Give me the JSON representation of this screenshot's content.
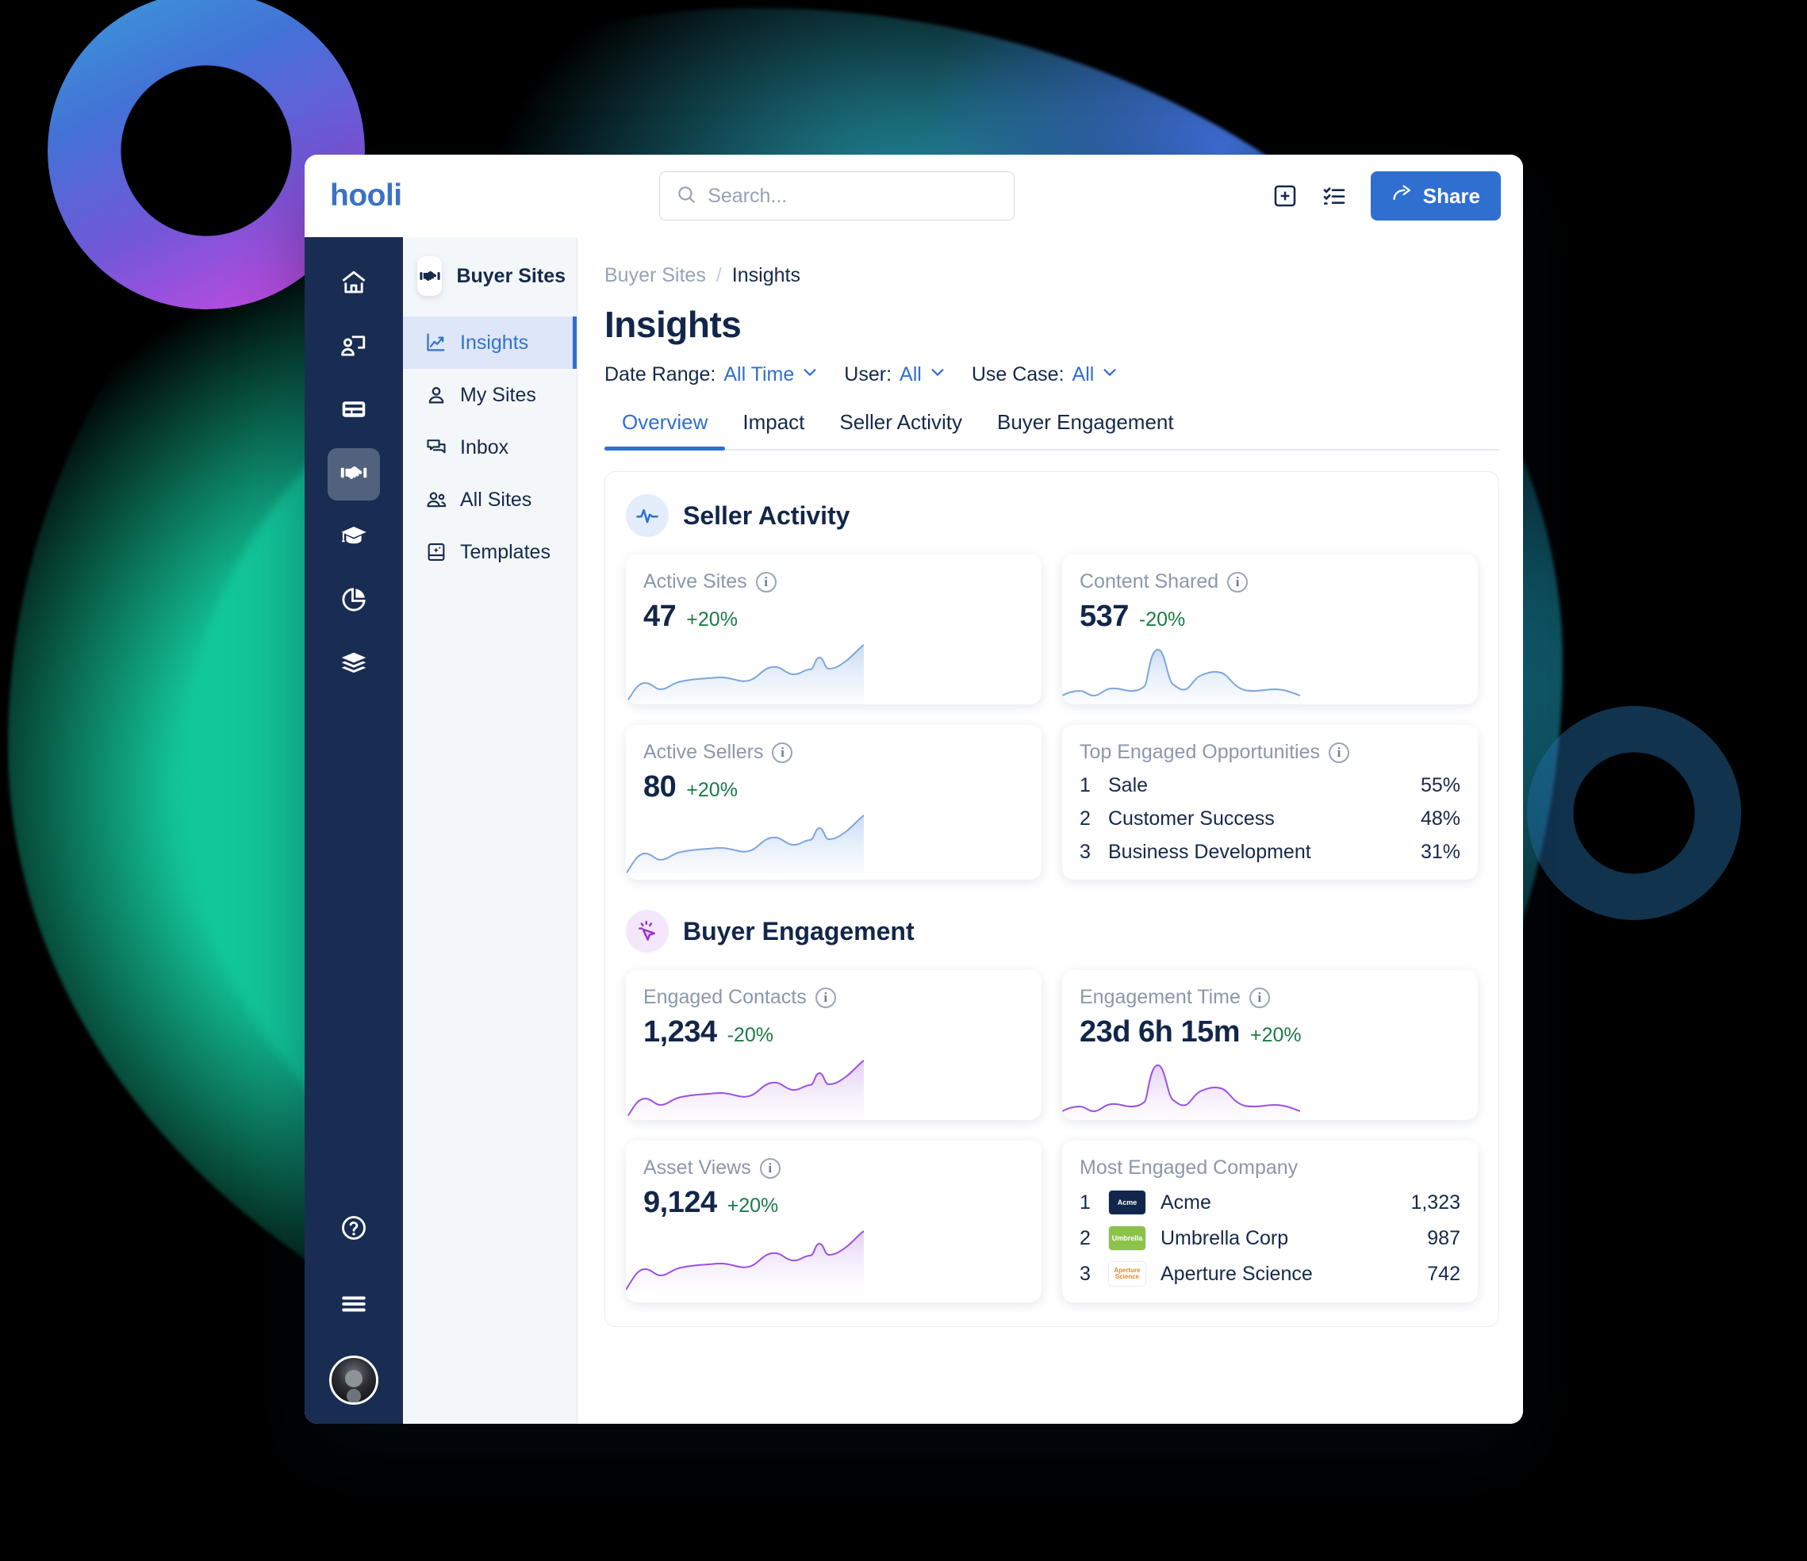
{
  "brand": {
    "name": "hooli",
    "color": "#3b72c4"
  },
  "topbar": {
    "search_placeholder": "Search...",
    "share_label": "Share",
    "icons": [
      "add-panel-icon",
      "checklist-icon",
      "share-icon"
    ]
  },
  "rail": {
    "items": [
      {
        "name": "home",
        "icon": "home-icon",
        "active": false
      },
      {
        "name": "presentations",
        "icon": "user-screen-icon",
        "active": false
      },
      {
        "name": "cards",
        "icon": "card-icon",
        "active": false
      },
      {
        "name": "buyer-sites",
        "icon": "handshake-icon",
        "active": true
      },
      {
        "name": "learning",
        "icon": "graduation-cap-icon",
        "active": false
      },
      {
        "name": "analytics",
        "icon": "pie-chart-icon",
        "active": false
      },
      {
        "name": "library",
        "icon": "stack-icon",
        "active": false
      }
    ],
    "bottom": [
      {
        "name": "help",
        "icon": "question-circle-icon"
      },
      {
        "name": "menu",
        "icon": "hamburger-icon"
      },
      {
        "name": "profile",
        "icon": "avatar"
      }
    ]
  },
  "subnav": {
    "title": "Buyer Sites",
    "title_icon": "handshake-icon",
    "items": [
      {
        "label": "Insights",
        "icon": "chart-line-icon",
        "active": true
      },
      {
        "label": "My Sites",
        "icon": "user-icon",
        "active": false
      },
      {
        "label": "Inbox",
        "icon": "chat-icon",
        "active": false
      },
      {
        "label": "All Sites",
        "icon": "users-icon",
        "active": false
      },
      {
        "label": "Templates",
        "icon": "template-icon",
        "active": false
      }
    ]
  },
  "breadcrumb": {
    "parent": "Buyer Sites",
    "separator": "/",
    "current": "Insights"
  },
  "page_title": "Insights",
  "filters": [
    {
      "label": "Date Range:",
      "value": "All Time"
    },
    {
      "label": "User:",
      "value": "All"
    },
    {
      "label": "Use Case:",
      "value": "All"
    }
  ],
  "tabs": [
    {
      "label": "Overview",
      "active": true
    },
    {
      "label": "Impact",
      "active": false
    },
    {
      "label": "Seller Activity",
      "active": false
    },
    {
      "label": "Buyer Engagement",
      "active": false
    }
  ],
  "sections": [
    {
      "title": "Seller Activity",
      "icon": "pulse-icon",
      "accent": "#2f6fd0",
      "cards": [
        {
          "label": "Active Sites",
          "value": "47",
          "delta": "+20%",
          "type": "sparkline",
          "sparkline": "rising"
        },
        {
          "label": "Content Shared",
          "value": "537",
          "delta": "-20%",
          "type": "sparkline",
          "sparkline": "spiky"
        },
        {
          "label": "Active Sellers",
          "value": "80",
          "delta": "+20%",
          "type": "sparkline",
          "sparkline": "rising"
        },
        {
          "label": "Top Engaged Opportunities",
          "type": "ranklist",
          "rows": [
            {
              "rank": "1",
              "name": "Sale",
              "value": "55%"
            },
            {
              "rank": "2",
              "name": "Customer Success",
              "value": "48%"
            },
            {
              "rank": "3",
              "name": "Business Development",
              "value": "31%"
            }
          ]
        }
      ]
    },
    {
      "title": "Buyer Engagement",
      "icon": "click-icon",
      "accent": "#9233c9",
      "cards": [
        {
          "label": "Engaged Contacts",
          "value": "1,234",
          "delta": "-20%",
          "type": "sparkline",
          "sparkline": "rising"
        },
        {
          "label": "Engagement Time",
          "value": "23d 6h 15m",
          "delta": "+20%",
          "type": "sparkline",
          "sparkline": "spiky"
        },
        {
          "label": "Asset Views",
          "value": "9,124",
          "delta": "+20%",
          "type": "sparkline",
          "sparkline": "rising"
        },
        {
          "label": "Most Engaged Company",
          "type": "companylist",
          "rows": [
            {
              "rank": "1",
              "logo": "Acme",
              "name": "Acme",
              "value": "1,323"
            },
            {
              "rank": "2",
              "logo": "Umbrella",
              "name": "Umbrella Corp",
              "value": "987"
            },
            {
              "rank": "3",
              "logo": "Aperture Science",
              "name": "Aperture Science",
              "value": "742"
            }
          ]
        }
      ]
    }
  ],
  "chart_data": [
    {
      "type": "area",
      "title": "Active Sites",
      "ylabel": "",
      "values": [
        6,
        14,
        11,
        13,
        18,
        20,
        20,
        22,
        19,
        20,
        27,
        30,
        26,
        25,
        31,
        36,
        34,
        31,
        40,
        44,
        52,
        62
      ],
      "color": "#8aaee0"
    },
    {
      "type": "area",
      "title": "Content Shared",
      "ylabel": "",
      "values": [
        8,
        10,
        7,
        13,
        14,
        11,
        10,
        12,
        16,
        52,
        60,
        22,
        14,
        26,
        34,
        36,
        32,
        22,
        14,
        13,
        15,
        12
      ],
      "color": "#8aaee0"
    },
    {
      "type": "area",
      "title": "Active Sellers",
      "ylabel": "",
      "values": [
        6,
        14,
        11,
        13,
        18,
        20,
        20,
        22,
        19,
        20,
        27,
        30,
        26,
        25,
        31,
        36,
        34,
        31,
        40,
        44,
        52,
        62
      ],
      "color": "#8aaee0"
    },
    {
      "type": "area",
      "title": "Engaged Contacts",
      "ylabel": "",
      "values": [
        6,
        14,
        11,
        13,
        18,
        20,
        20,
        22,
        19,
        20,
        27,
        30,
        26,
        25,
        31,
        36,
        34,
        31,
        40,
        44,
        52,
        62
      ],
      "color": "#9b51e0"
    },
    {
      "type": "area",
      "title": "Engagement Time",
      "ylabel": "",
      "values": [
        8,
        10,
        7,
        13,
        14,
        11,
        10,
        12,
        16,
        52,
        60,
        22,
        14,
        26,
        34,
        36,
        32,
        22,
        14,
        13,
        15,
        12
      ],
      "color": "#9b51e0"
    },
    {
      "type": "area",
      "title": "Asset Views",
      "ylabel": "",
      "values": [
        6,
        14,
        11,
        13,
        18,
        20,
        20,
        22,
        19,
        20,
        27,
        30,
        26,
        25,
        31,
        36,
        34,
        31,
        40,
        44,
        52,
        62
      ],
      "color": "#9b51e0"
    },
    {
      "type": "bar",
      "title": "Top Engaged Opportunities",
      "categories": [
        "Sale",
        "Customer Success",
        "Business Development"
      ],
      "values": [
        55,
        48,
        31
      ],
      "ylabel": "%"
    },
    {
      "type": "bar",
      "title": "Most Engaged Company",
      "categories": [
        "Acme",
        "Umbrella Corp",
        "Aperture Science"
      ],
      "values": [
        1323,
        987,
        742
      ],
      "ylabel": ""
    }
  ]
}
